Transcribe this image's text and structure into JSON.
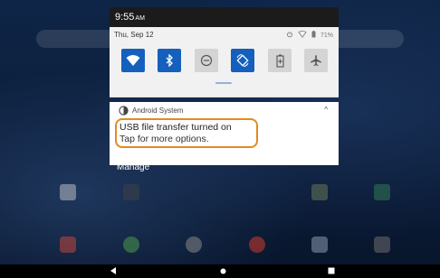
{
  "shade": {
    "time": "9:55",
    "ampm": "AM",
    "date": "Thu, Sep 12",
    "battery": "71%",
    "tiles": [
      {
        "icon": "wifi-icon",
        "on": true
      },
      {
        "icon": "bluetooth-icon",
        "on": true
      },
      {
        "icon": "do-not-disturb-icon",
        "on": false
      },
      {
        "icon": "auto-rotate-icon",
        "on": true
      },
      {
        "icon": "battery-saver-icon",
        "on": false
      },
      {
        "icon": "airplane-mode-icon",
        "on": false
      }
    ]
  },
  "notification": {
    "app": "Android System",
    "title": "USB file transfer turned on",
    "text": "Tap for more options."
  },
  "manage_label": "Manage",
  "colors": {
    "accent": "#1560bd",
    "highlight": "#e58a1f",
    "shade_bg": "#f1f1f1"
  }
}
